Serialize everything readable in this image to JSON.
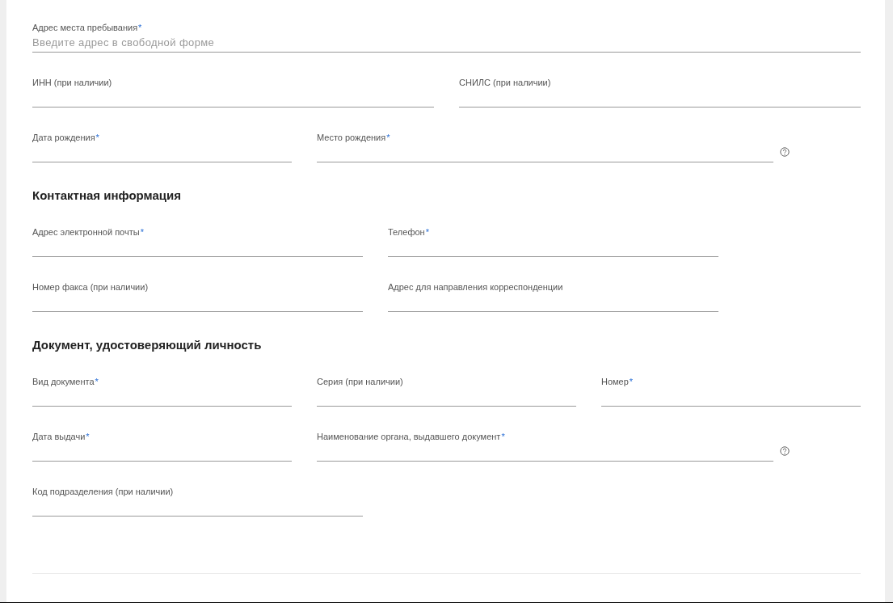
{
  "required_mark": "*",
  "sections": [
    {
      "rows": [
        {
          "fields": [
            {
              "label": "Адрес места пребывания",
              "required": true,
              "placeholder": "Введите адрес в свободной форме",
              "help": false
            }
          ]
        },
        {
          "fields": [
            {
              "label": "ИНН (при наличии)",
              "required": false,
              "help": false
            },
            {
              "label": "СНИЛС (при наличии)",
              "required": false,
              "help": false
            }
          ]
        },
        {
          "fields": [
            {
              "label": "Дата рождения",
              "required": true,
              "help": false
            },
            {
              "label": "Место рождения",
              "required": true,
              "help": true
            }
          ]
        }
      ]
    },
    {
      "heading": "Контактная информация",
      "rows": [
        {
          "fields": [
            {
              "label": "Адрес электронной почты",
              "required": true,
              "help": false
            },
            {
              "label": "Телефон",
              "required": true,
              "help": false
            }
          ]
        },
        {
          "fields": [
            {
              "label": "Номер факса (при наличии)",
              "required": false,
              "help": false
            },
            {
              "label": "Адрес для направления корреспонденции",
              "required": false,
              "help": false
            }
          ]
        }
      ]
    },
    {
      "heading": "Документ, удостоверяющий личность",
      "rows": [
        {
          "fields": [
            {
              "label": "Вид документа",
              "required": true,
              "help": false
            },
            {
              "label": "Серия (при наличии)",
              "required": false,
              "help": false
            },
            {
              "label": "Номер",
              "required": true,
              "help": false
            }
          ]
        },
        {
          "fields": [
            {
              "label": "Дата выдачи",
              "required": true,
              "help": false
            },
            {
              "label": "Наименование органа, выдавшего документ",
              "required": true,
              "help": true
            }
          ]
        },
        {
          "fields": [
            {
              "label": "Код подразделения (при наличии)",
              "required": false,
              "help": false
            }
          ]
        }
      ]
    }
  ]
}
